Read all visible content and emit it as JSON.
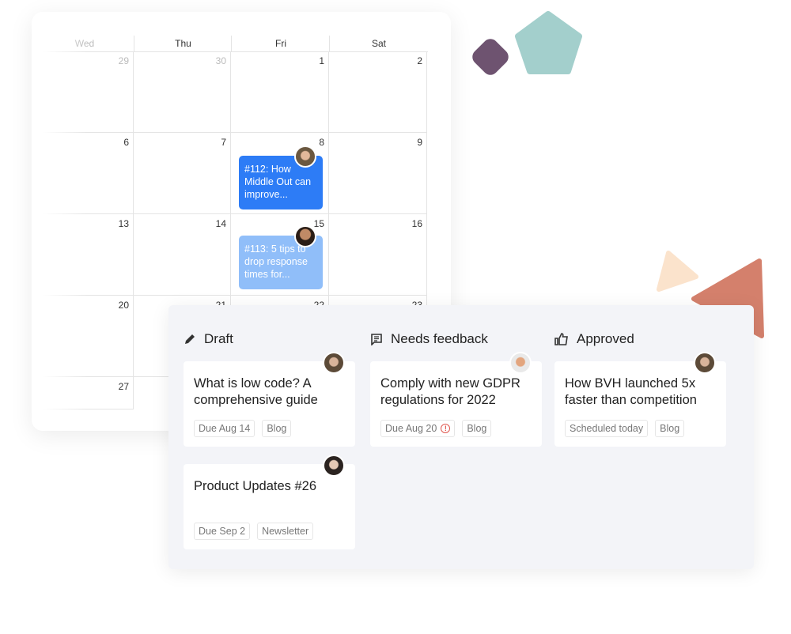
{
  "calendar": {
    "weekdays": [
      "Wed",
      "Thu",
      "Fri",
      "Sat"
    ],
    "weeks": [
      [
        "29",
        "30",
        "1",
        "2"
      ],
      [
        "6",
        "7",
        "8",
        "9"
      ],
      [
        "13",
        "14",
        "15",
        "16"
      ],
      [
        "20",
        "21",
        "22",
        "23"
      ],
      [
        "27",
        "",
        "",
        ""
      ]
    ],
    "events": [
      {
        "text": "#112: How Middle Out can improve...",
        "color": "#2d7cf6"
      },
      {
        "text": "#113: 5 tips to drop response times for...",
        "color": "#90bef9"
      }
    ]
  },
  "board": {
    "columns": [
      {
        "label": "Draft",
        "icon": "pencil-icon",
        "cards": [
          {
            "title": "What is low code? A comprehensive guide",
            "tags": [
              "Due Aug 14",
              "Blog"
            ]
          },
          {
            "title": "Product Updates #26",
            "tags": [
              "Due Sep 2",
              "Newsletter"
            ]
          }
        ]
      },
      {
        "label": "Needs feedback",
        "icon": "comment-icon",
        "cards": [
          {
            "title": "Comply with new GDPR regulations for 2022",
            "tags": [
              "Due Aug 20",
              "Blog"
            ],
            "warning": "!"
          }
        ]
      },
      {
        "label": "Approved",
        "icon": "thumbs-up-icon",
        "cards": [
          {
            "title": "How BVH launched 5x faster than competition",
            "tags": [
              "Scheduled today",
              "Blog"
            ]
          }
        ]
      }
    ]
  },
  "colors": {
    "diamond": "#6e5370",
    "pentagon": "#a3cfcc",
    "peach": "#fbe3cc",
    "salmon": "#d4806c"
  }
}
